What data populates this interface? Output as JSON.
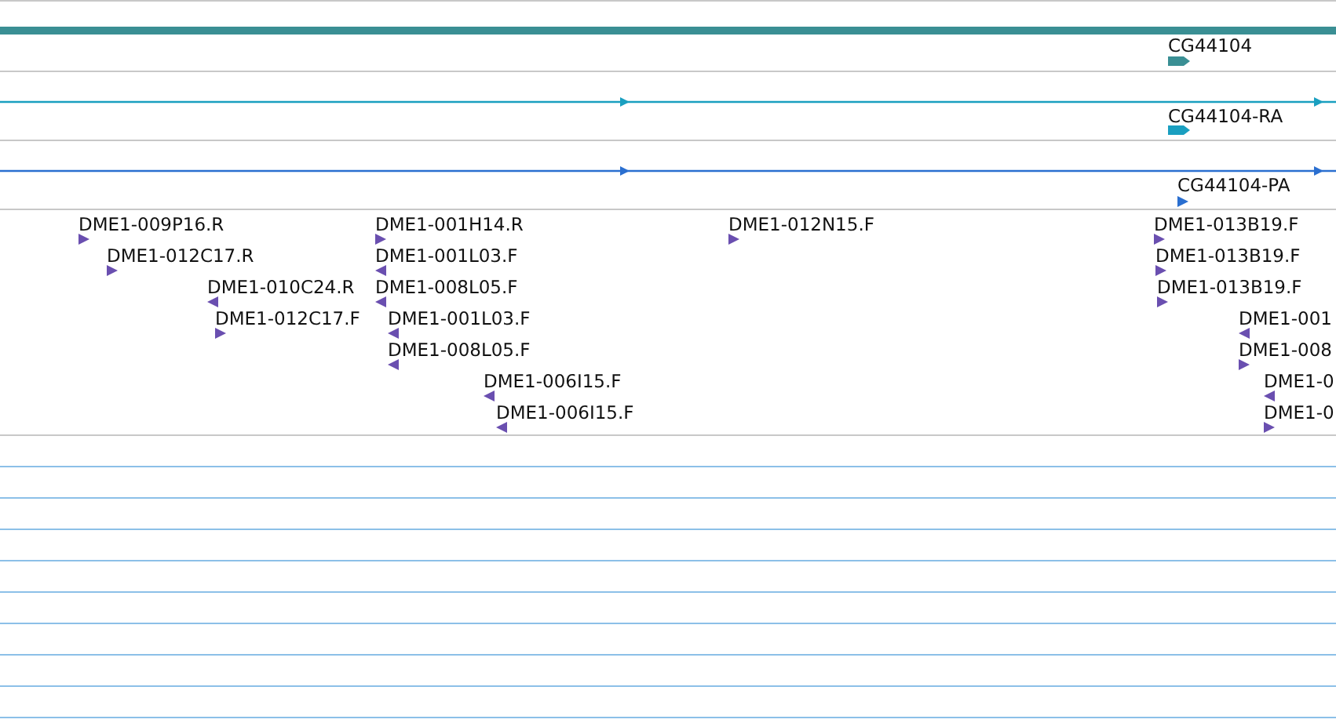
{
  "tracks": [
    {
      "kind": "gene",
      "color": "#3a8f94",
      "features": [
        {
          "label": "CG44104",
          "forward": true
        }
      ]
    },
    {
      "kind": "transcript",
      "color": "#1a9fc0",
      "features": [
        {
          "label": "CG44104-RA",
          "forward": true
        }
      ]
    },
    {
      "kind": "transcript",
      "color": "#2a6fd0",
      "features": [
        {
          "label": "CG44104-PA",
          "forward": true
        }
      ]
    },
    {
      "kind": "reads",
      "color": "#6a4fb0",
      "features": [
        {
          "label": "DME1-009P16.R",
          "forward": true
        },
        {
          "label": "DME1-012C17.R",
          "forward": true
        },
        {
          "label": "DME1-010C24.R",
          "forward": false
        },
        {
          "label": "DME1-012C17.F",
          "forward": true
        },
        {
          "label": "DME1-001H14.R",
          "forward": true
        },
        {
          "label": "DME1-001L03.F",
          "forward": false
        },
        {
          "label": "DME1-008L05.F",
          "forward": false
        },
        {
          "label": "DME1-001L03.F",
          "forward": false
        },
        {
          "label": "DME1-008L05.F",
          "forward": false
        },
        {
          "label": "DME1-006I15.F",
          "forward": false
        },
        {
          "label": "DME1-006I15.F",
          "forward": false
        },
        {
          "label": "DME1-012N15.F",
          "forward": true
        },
        {
          "label": "DME1-013B19.F",
          "forward": true
        },
        {
          "label": "DME1-013B19.F",
          "forward": true
        },
        {
          "label": "DME1-013B19.F",
          "forward": true
        },
        {
          "label": "DME1-001",
          "forward": false
        },
        {
          "label": "DME1-008",
          "forward": true
        },
        {
          "label": "DME1-0",
          "forward": false
        },
        {
          "label": "DME1-0",
          "forward": true
        }
      ]
    },
    {
      "kind": "empty"
    }
  ]
}
